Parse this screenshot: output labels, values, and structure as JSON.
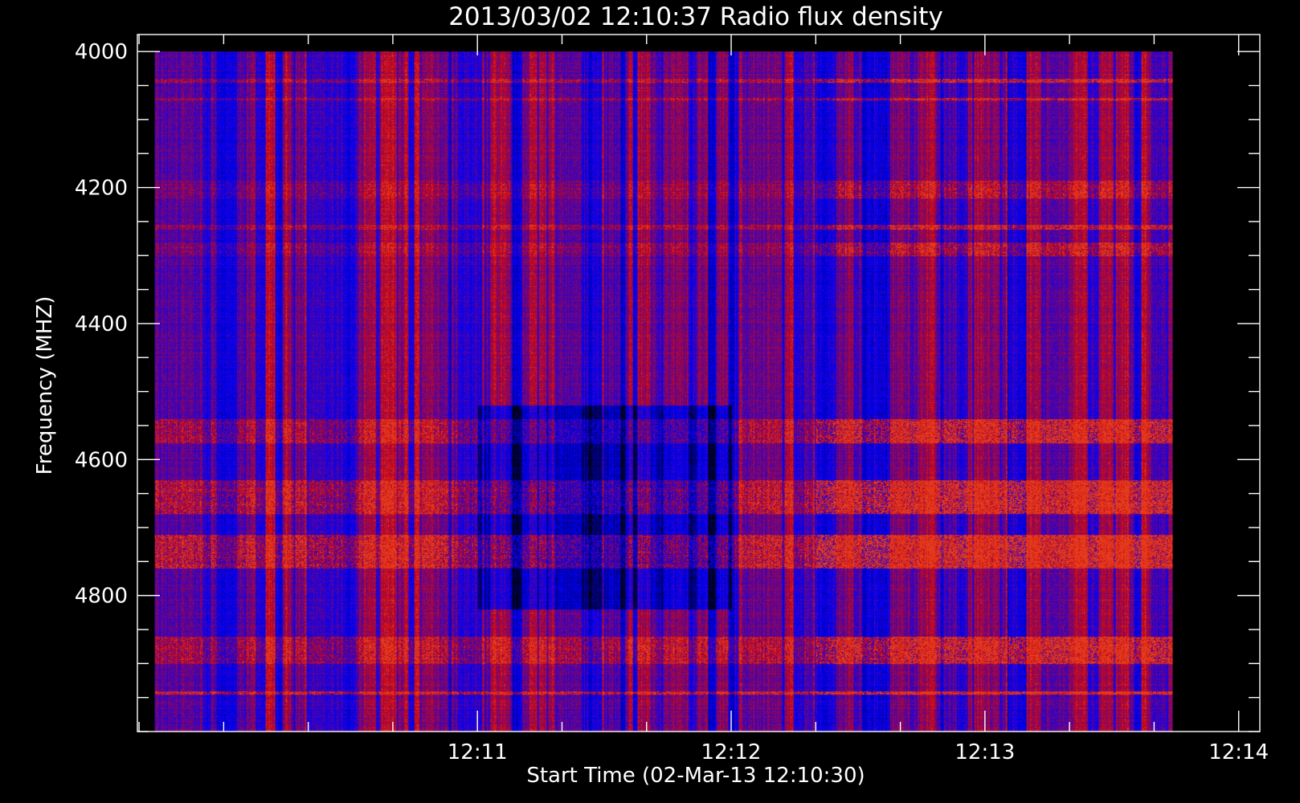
{
  "chart_data": {
    "type": "heatmap",
    "title": "2013/03/02 12:10:37 Radio flux density",
    "xlabel": "Start Time (02-Mar-13 12:10:30)",
    "ylabel": "Frequency (MHZ)",
    "x_ticks": [
      "12:11",
      "12:12",
      "12:13",
      "12:14"
    ],
    "x_tick_seconds": [
      60,
      120,
      180,
      240
    ],
    "x_range_seconds": [
      -20.4,
      245
    ],
    "data_x_range_seconds": [
      -16.3,
      224.4
    ],
    "y_ticks": [
      "4000",
      "4200",
      "4400",
      "4600",
      "4800"
    ],
    "y_tick_values": [
      4000,
      4200,
      4400,
      4600,
      4800
    ],
    "y_range": [
      3975,
      5000
    ],
    "data_y_range": [
      4000,
      5000
    ],
    "y_inverted": true,
    "colors": {
      "background": "#000000",
      "axes": "#ffffff",
      "low": "#000000",
      "mid": "#0000ff",
      "high": "#dc0a0a",
      "peak": "#ffff96"
    },
    "bands": [
      {
        "freq": [
          4040,
          4045
        ],
        "level": 0.55
      },
      {
        "freq": [
          4068,
          4072
        ],
        "level": 0.5
      },
      {
        "freq": [
          4190,
          4215
        ],
        "level": 0.3
      },
      {
        "freq": [
          4255,
          4262
        ],
        "level": 0.45
      },
      {
        "freq": [
          4280,
          4300
        ],
        "level": 0.35
      },
      {
        "freq": [
          4540,
          4575
        ],
        "level": 0.55
      },
      {
        "freq": [
          4630,
          4680
        ],
        "level": 0.65
      },
      {
        "freq": [
          4710,
          4760
        ],
        "level": 0.75
      },
      {
        "freq": [
          4860,
          4900
        ],
        "level": 0.55
      },
      {
        "freq": [
          4940,
          4945
        ],
        "level": 0.9
      }
    ]
  }
}
